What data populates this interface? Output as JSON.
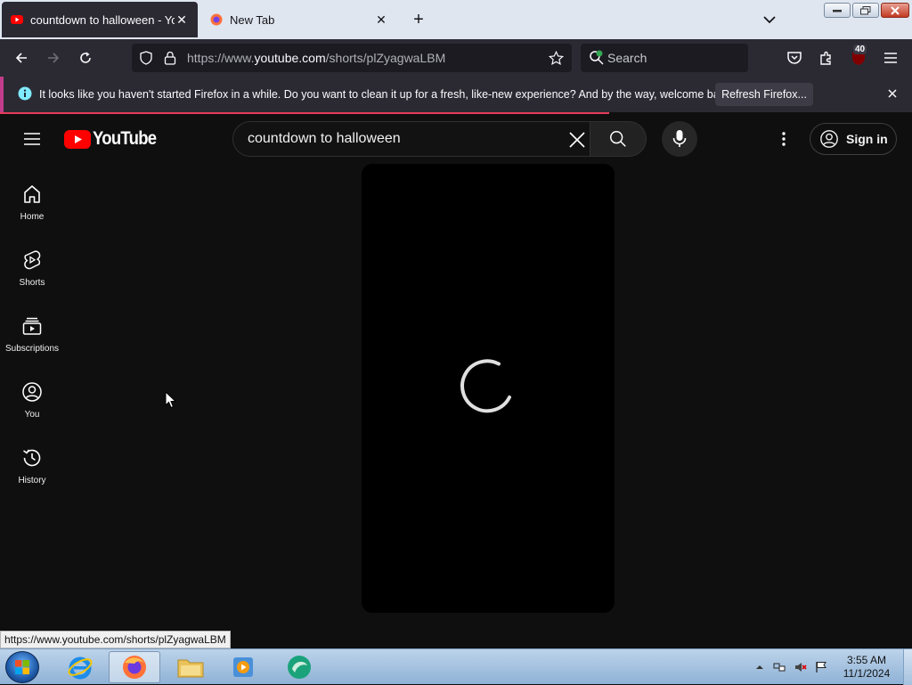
{
  "browser": {
    "tabs": [
      {
        "title": "countdown to halloween - YouTube",
        "active": true
      },
      {
        "title": "New Tab",
        "active": false
      }
    ],
    "url": {
      "prefix": "https://www.",
      "host": "youtube.com",
      "path": "/shorts/plZyagwaLBM"
    },
    "search_placeholder": "Search",
    "extensions_badge": "40",
    "notification": {
      "message": "It looks like you haven't started Firefox in a while. Do you want to clean it up for a fresh, like-new experience? And by the way, welcome back!",
      "button": "Refresh Firefox..."
    },
    "status_url": "https://www.youtube.com/shorts/plZyagwaLBM"
  },
  "youtube": {
    "logo_text": "YouTube",
    "search_query": "countdown to halloween",
    "sign_in_label": "Sign in",
    "sidebar": [
      {
        "label": "Home",
        "icon": "home-icon"
      },
      {
        "label": "Shorts",
        "icon": "shorts-icon"
      },
      {
        "label": "Subscriptions",
        "icon": "subscriptions-icon"
      },
      {
        "label": "You",
        "icon": "you-icon"
      },
      {
        "label": "History",
        "icon": "history-icon"
      }
    ],
    "player_state": "loading"
  },
  "taskbar": {
    "time": "3:55 AM",
    "date": "11/1/2024",
    "pinned": [
      "internet-explorer",
      "firefox",
      "file-explorer",
      "media-player",
      "app"
    ]
  },
  "colors": {
    "youtube_red": "#ff0000",
    "page_bg": "#0f0f0f",
    "progress": "#e63b5a",
    "notif_accent": "#c13d8b"
  }
}
